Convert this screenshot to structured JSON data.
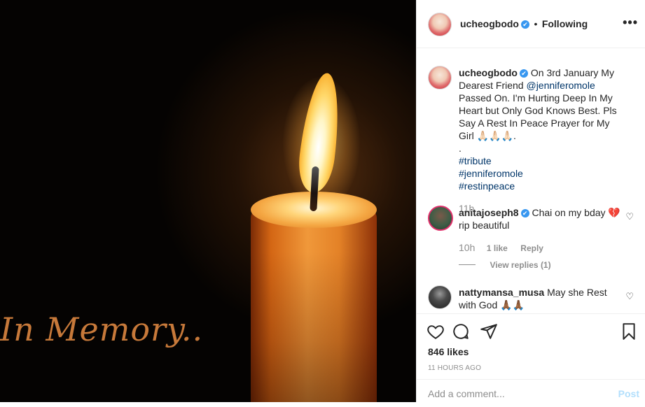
{
  "media": {
    "overlay_text": "In Memory.."
  },
  "header": {
    "username": "ucheogbodo",
    "verified_mark": "✔",
    "separator": "•",
    "follow_status": "Following",
    "more_icon": "more-icon",
    "more_glyph": "•••"
  },
  "caption": {
    "username": "ucheogbodo",
    "text_before_mention": "On 3rd January My Dearest Friend ",
    "mention": "@jenniferomole",
    "text_after_mention": " Passed On. I'm Hurting Deep In My Heart but Only God Knows Best. Pls Say A Rest In Peace Prayer for My Girl 🙏🏻🙏🏻🙏🏻.",
    "dot": ".",
    "hashtags": [
      "#tribute",
      "#jenniferomole",
      "#restinpeace"
    ],
    "age": "11h"
  },
  "comments": [
    {
      "username": "anitajoseph8",
      "verified": true,
      "text": "Chai on my bday 💔 rip beautiful",
      "age": "10h",
      "likes": "1 like",
      "reply": "Reply",
      "view_replies": "View replies (1)"
    },
    {
      "username": "nattymansa_musa",
      "verified": false,
      "text": "May she Rest with God 🙏🏾🙏🏾"
    }
  ],
  "actions": {
    "like_icon": "heart-icon",
    "comment_icon": "comment-icon",
    "share_icon": "share-icon",
    "save_icon": "bookmark-icon",
    "likes_count": "846 likes",
    "timestamp": "11 HOURS AGO"
  },
  "comment_box": {
    "placeholder": "Add a comment...",
    "post_label": "Post"
  },
  "colors": {
    "link": "#003569",
    "verified": "#3897f0",
    "muted": "#8e8e8e",
    "post_disabled": "#b2dffc"
  }
}
